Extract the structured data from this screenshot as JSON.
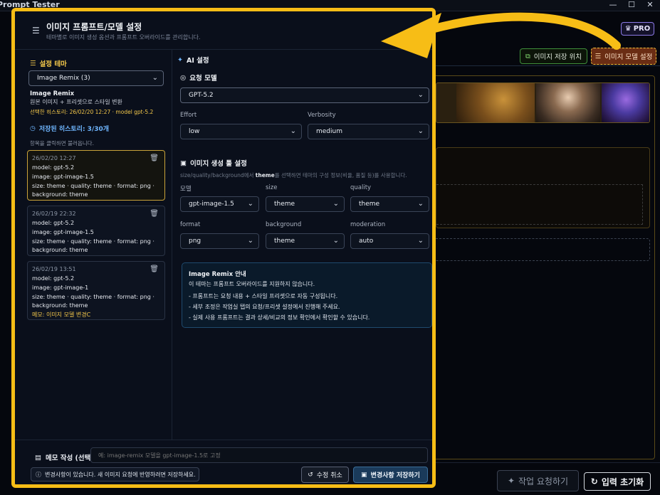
{
  "window": {
    "title": "Prompt Tester"
  },
  "app": {
    "pro_label": "PRO",
    "image_location_label": "이미지 저장 위치",
    "image_model_label": "이미지 모델 설정",
    "request_label": "작업 요청하기",
    "reset_label": "입력 초기화"
  },
  "modal": {
    "title": "이미지 프롬프트/모델 설정",
    "subtitle": "테마별로 이미지 생성 옵션과 프롬프트 오버라이드를 관리합니다.",
    "left": {
      "theme_heading": "설정 테마",
      "theme_value": "Image Remix (3)",
      "theme_name": "Image Remix",
      "theme_desc": "원본 이미지 + 프리셋으로 스타일 변환",
      "selected_history": "선택한 히스토리: 26/02/20 12:27 · model gpt-5.2",
      "saved_heading": "저장된 히스토리: 3/30개",
      "saved_hint": "항목을 클릭하면 불러옵니다.",
      "history": [
        {
          "date": "26/02/20 12:27",
          "model": "model: gpt-5.2",
          "image": "image: gpt-image-1.5",
          "size": "size: theme · quality: theme · format: png ·",
          "background": "background: theme",
          "memo": ""
        },
        {
          "date": "26/02/19 22:32",
          "model": "model: gpt-5.2",
          "image": "image: gpt-image-1.5",
          "size": "size: theme · quality: theme · format: png ·",
          "background": "background: theme",
          "memo": ""
        },
        {
          "date": "26/02/19 13:51",
          "model": "model: gpt-5.2",
          "image": "image: gpt-image-1",
          "size": "size: theme · quality: theme · format: png ·",
          "background": "background: theme",
          "memo": "메모: 이미지 모델 변경C"
        }
      ]
    },
    "right": {
      "ai_heading": "AI 설정",
      "req_model_heading": "요청 모델",
      "req_model_value": "GPT-5.2",
      "effort_label": "Effort",
      "effort_value": "low",
      "verbosity_label": "Verbosity",
      "verbosity_value": "medium",
      "img_tool_heading": "이미지 생성 툴 설정",
      "img_tool_hint_pre": "size/quality/background에서 ",
      "img_tool_hint_bold": "theme",
      "img_tool_hint_post": "를 선택하면 테마의 구성 정보(비율, 품질 등)를 사용합니다.",
      "model_label": "모델",
      "model_value": "gpt-image-1.5",
      "size_label": "size",
      "size_value": "theme",
      "quality_label": "quality",
      "quality_value": "theme",
      "format_label": "format",
      "format_value": "png",
      "background_label": "background",
      "background_value": "theme",
      "moderation_label": "moderation",
      "moderation_value": "auto",
      "info_title": "Image Remix 안내",
      "info_line1": "이 테마는 프롬프트 오버라이드를 지원하지 않습니다.",
      "info_line2": "- 프롬프트는 요청 내용 + 스타일 프리셋으로 자동 구성됩니다.",
      "info_line3": "- 세부 조정은 작업실 탭의 요청/프리셋 설정에서 진행해 주세요.",
      "info_line4": "- 실제 사용 프롬프트는 결과 상세/비교의 정보 확인에서 확인할 수 있습니다."
    },
    "footer": {
      "memo_label": "메모 작성 (선택)",
      "memo_placeholder": "예: image-remix 모델을 gpt-image-1.5로 고정",
      "notice": "변경사항이 있습니다. 새 이미지 요청에 반영하려면 저장하세요.",
      "cancel_label": "수정 취소",
      "save_label": "변경사항 저장하기"
    }
  },
  "colors": {
    "highlight": "#f7bd16",
    "accent_orange": "#6a2d14",
    "info_border": "#1f4a6e"
  }
}
